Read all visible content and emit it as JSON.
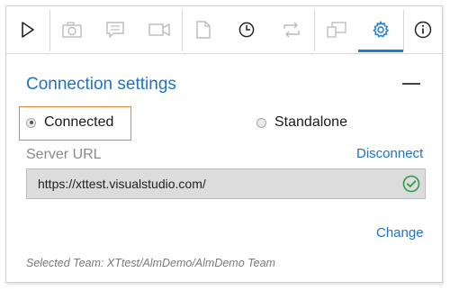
{
  "toolbar": {
    "buttons": [
      {
        "icon": "play-icon",
        "enabled": true
      },
      {
        "icon": "camera-icon",
        "enabled": false
      },
      {
        "icon": "comment-icon",
        "enabled": false
      },
      {
        "icon": "video-icon",
        "enabled": false
      },
      {
        "icon": "document-icon",
        "enabled": false
      },
      {
        "icon": "clock-icon",
        "enabled": true
      },
      {
        "icon": "sync-icon",
        "enabled": false
      },
      {
        "icon": "screens-icon",
        "enabled": false
      },
      {
        "icon": "gear-icon",
        "enabled": true,
        "active": true
      },
      {
        "icon": "info-icon",
        "enabled": true
      }
    ],
    "accent_color": "#1e7ad2"
  },
  "connection": {
    "title": "Connection settings",
    "modes": {
      "connected_label": "Connected",
      "standalone_label": "Standalone",
      "selected": "Connected"
    },
    "server_label": "Server URL",
    "disconnect_label": "Disconnect",
    "server_url": "https://xttest.visualstudio.com/",
    "change_label": "Change",
    "selected_team": "Selected Team: XTtest/AlmDemo/AlmDemo Team"
  },
  "colors": {
    "link": "#1e73c8",
    "highlight": "#e0853a",
    "valid": "#2e9d4a"
  }
}
